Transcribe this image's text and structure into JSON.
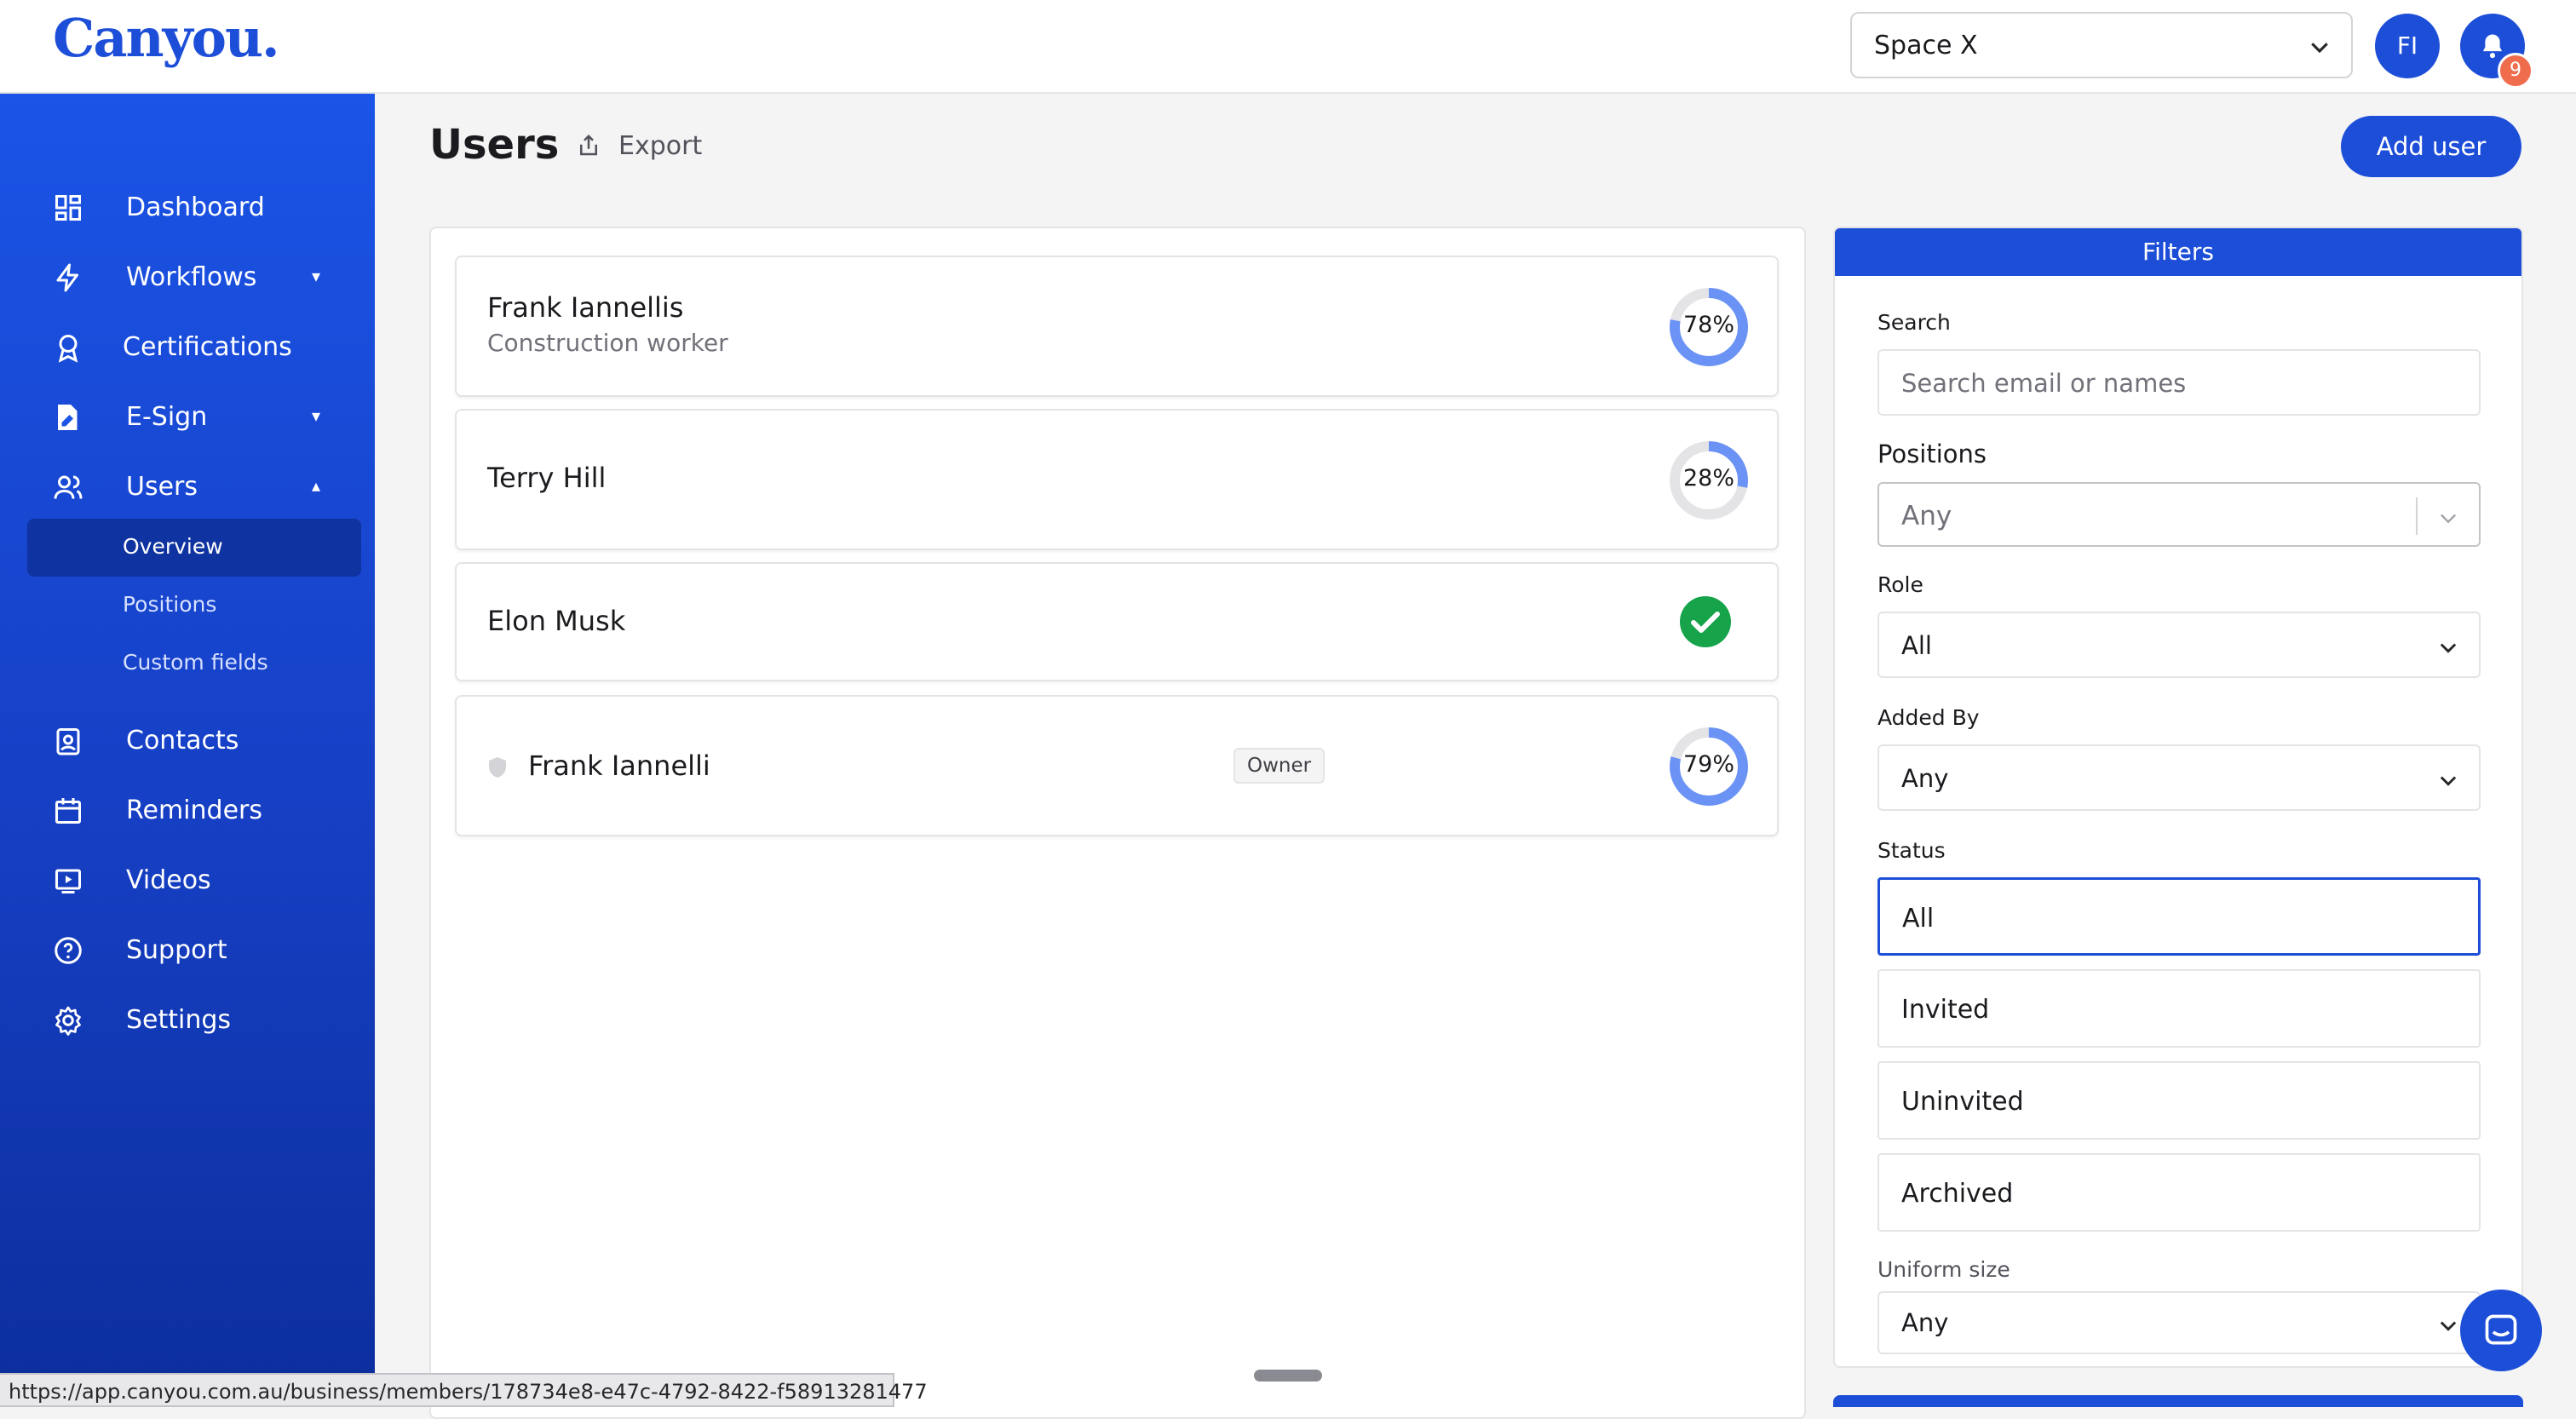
{
  "header": {
    "logo": "Canyou.",
    "space_selected": "Space X",
    "avatar_initials": "FI",
    "notification_count": "9"
  },
  "sidebar": {
    "items": [
      {
        "label": "Dashboard",
        "icon": "dashboard-icon"
      },
      {
        "label": "Workflows",
        "icon": "lightning-icon"
      },
      {
        "label": "Certifications",
        "icon": "award-icon"
      },
      {
        "label": "E-Sign",
        "icon": "signature-icon"
      },
      {
        "label": "Users",
        "icon": "users-icon"
      },
      {
        "label": "Contacts",
        "icon": "contact-card-icon"
      },
      {
        "label": "Reminders",
        "icon": "calendar-icon"
      },
      {
        "label": "Videos",
        "icon": "video-icon"
      },
      {
        "label": "Support",
        "icon": "help-icon"
      },
      {
        "label": "Settings",
        "icon": "gear-icon"
      }
    ],
    "users_sub": [
      "Overview",
      "Positions",
      "Custom fields"
    ]
  },
  "main": {
    "title": "Users",
    "export_label": "Export",
    "add_user_label": "Add user"
  },
  "users": [
    {
      "name": "Frank Iannellis",
      "role": "Construction worker",
      "progress": 78,
      "progress_label": "78%"
    },
    {
      "name": "Terry Hill",
      "progress": 28,
      "progress_label": "28%"
    },
    {
      "name": "Elon Musk",
      "complete": true
    },
    {
      "name": "Frank Iannelli",
      "badge": "Owner",
      "progress": 79,
      "progress_label": "79%"
    }
  ],
  "filters": {
    "title": "Filters",
    "search_label": "Search",
    "search_placeholder": "Search email or names",
    "positions_label": "Positions",
    "positions_value": "Any",
    "role_label": "Role",
    "role_value": "All",
    "added_by_label": "Added By",
    "added_by_value": "Any",
    "status_label": "Status",
    "status_options": [
      "All",
      "Invited",
      "Uninvited",
      "Archived"
    ],
    "status_selected": "All",
    "uniform_label": "Uniform size",
    "uniform_value": "Any"
  },
  "status_bar_url": "https://app.canyou.com.au/business/members/178734e8-e47c-4792-8422-f58913281477",
  "colors": {
    "brand": "#1d4ed8",
    "ring_fill": "#6b93f5",
    "ring_track": "#e4e4e7",
    "success": "#16a34a",
    "badge": "#ef6c4d"
  }
}
